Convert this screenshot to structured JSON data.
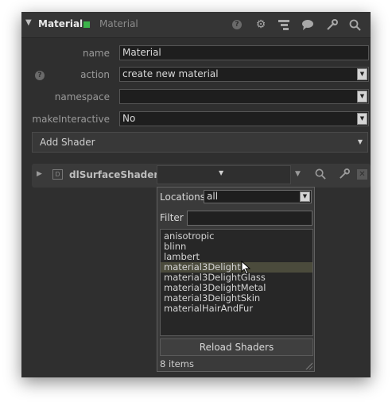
{
  "header": {
    "title": "Material",
    "type_label": "Material",
    "status_color": "#3cb34a",
    "icons": [
      "help-icon",
      "gear-icon",
      "hierarchy-icon",
      "comment-icon",
      "wrench-icon",
      "search-icon"
    ]
  },
  "params": {
    "name": {
      "label": "name",
      "value": "Material"
    },
    "action": {
      "label": "action",
      "value": "create new material"
    },
    "namespace": {
      "label": "namespace",
      "value": ""
    },
    "make_interactive": {
      "label": "makeInteractive",
      "value": "No"
    }
  },
  "add_shader": {
    "label": "Add Shader"
  },
  "shader_row": {
    "name": "dlSurfaceShader",
    "badge": "D"
  },
  "popup": {
    "locations_label": "Locations",
    "locations_value": "all",
    "filter_label": "Filter",
    "filter_value": "",
    "items": [
      "anisotropic",
      "blinn",
      "lambert",
      "material3Delight",
      "material3DelightGlass",
      "material3DelightMetal",
      "material3DelightSkin",
      "materialHairAndFur"
    ],
    "hovered_item": "material3Delight",
    "reload_label": "Reload Shaders",
    "count_text": "8 items"
  }
}
